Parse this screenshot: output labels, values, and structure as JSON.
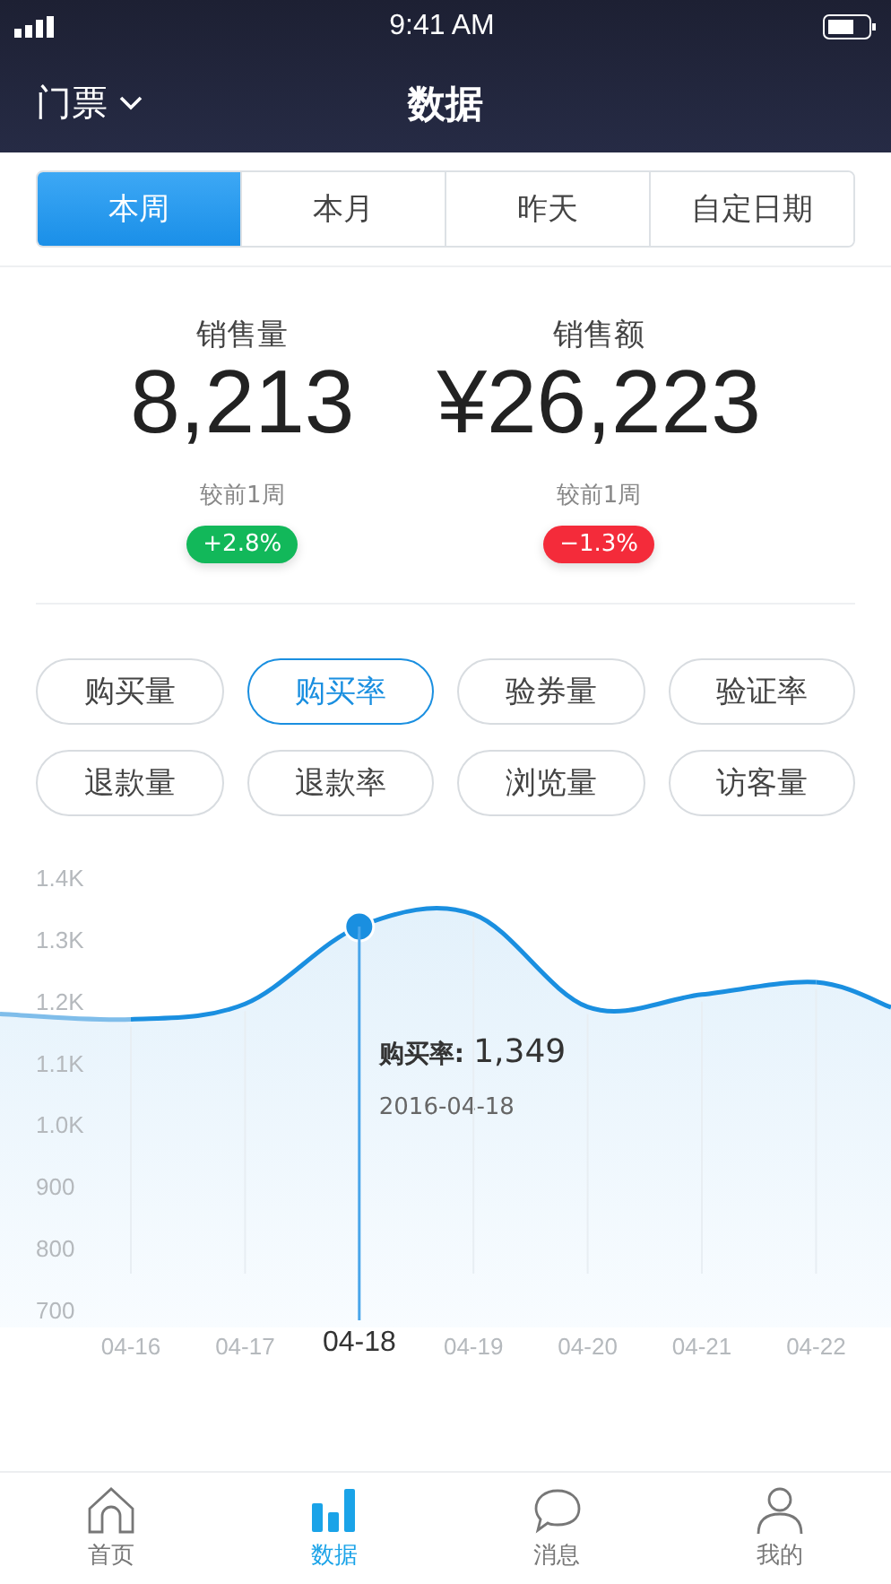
{
  "status_bar": {
    "time": "9:41 AM"
  },
  "nav": {
    "menu": "门票",
    "title": "数据"
  },
  "period_tabs": [
    {
      "label": "本周",
      "selected": true
    },
    {
      "label": "本月",
      "selected": false
    },
    {
      "label": "昨天",
      "selected": false
    },
    {
      "label": "自定日期",
      "selected": false
    }
  ],
  "stats": [
    {
      "label": "销售量",
      "value": "8,213",
      "compare": "较前1周",
      "delta": "+2.8%",
      "color": "#12b85a"
    },
    {
      "label": "销售额",
      "value": "¥26,223",
      "compare": "较前1周",
      "delta": "−1.3%",
      "color": "#f42b3a"
    }
  ],
  "metrics": [
    {
      "label": "购买量",
      "selected": false
    },
    {
      "label": "购买率",
      "selected": true
    },
    {
      "label": "验券量",
      "selected": false
    },
    {
      "label": "验证率",
      "selected": false
    },
    {
      "label": "退款量",
      "selected": false
    },
    {
      "label": "退款率",
      "selected": false
    },
    {
      "label": "浏览量",
      "selected": false
    },
    {
      "label": "访客量",
      "selected": false
    }
  ],
  "chart": {
    "chart_data": {
      "type": "area",
      "categories": [
        "04-16",
        "04-17",
        "04-18",
        "04-19",
        "04-20",
        "04-21",
        "04-22"
      ],
      "series": [
        {
          "color": "#1a8fe0",
          "values": [
            1170,
            1195,
            1320,
            1340,
            1190,
            1210,
            1230
          ]
        }
      ],
      "ylim": [
        700,
        1400
      ],
      "yticks": [
        {
          "value": 1400,
          "label": "1.4K"
        },
        {
          "value": 1300,
          "label": "1.3K"
        },
        {
          "value": 1200,
          "label": "1.2K"
        },
        {
          "value": 1100,
          "label": "1.1K"
        },
        {
          "value": 1000,
          "label": "1.0K"
        },
        {
          "value": 900,
          "label": "900"
        },
        {
          "value": 800,
          "label": "800"
        },
        {
          "value": 700,
          "label": "700"
        }
      ],
      "annotations": [
        "1,349"
      ]
    },
    "tooltip": {
      "label": "购买率:",
      "date": "2016-04-18"
    }
  },
  "tab_bar": [
    {
      "label": "首页",
      "selected": false
    },
    {
      "label": "数据",
      "selected": true
    },
    {
      "label": "消息",
      "selected": false
    },
    {
      "label": "我的",
      "selected": false
    }
  ]
}
